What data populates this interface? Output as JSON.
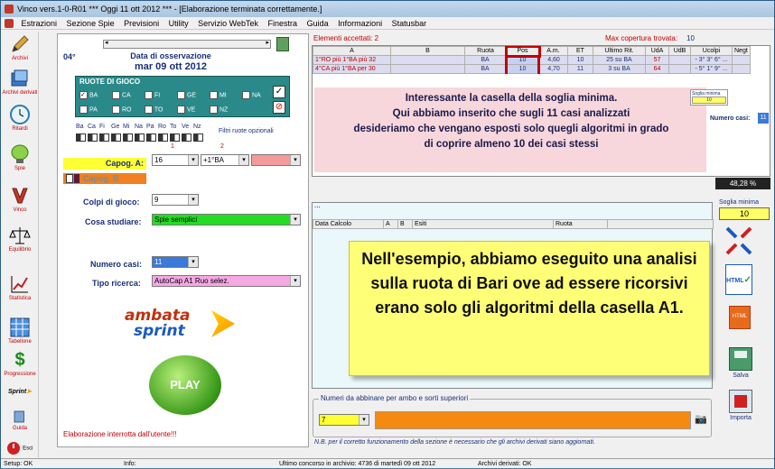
{
  "window": {
    "title": "Vinco vers.1-0-R01  ***  Oggi 11 ott 2012  ***   - [Elaborazione terminata correttamente.]"
  },
  "menu": [
    "Estrazioni",
    "Sezione Spie",
    "Previsioni",
    "Utility",
    "Servizio WebTek",
    "Finestra",
    "Guida",
    "Informazioni",
    "Statusbar"
  ],
  "toolbar": [
    {
      "label": "Archivi",
      "icon": "pencil-icon"
    },
    {
      "label": "Archivi derivati",
      "icon": "archive-icon"
    },
    {
      "label": "Ritardi",
      "icon": "clock-icon"
    },
    {
      "label": "Spie",
      "icon": "lamp-icon"
    },
    {
      "label": "Vinco",
      "icon": "vinco-logo-icon"
    },
    {
      "label": "Equilibrio",
      "icon": "scale-icon"
    },
    {
      "label": "Statistica",
      "icon": "chart-icon"
    },
    {
      "label": "Tabellone",
      "icon": "table-icon"
    },
    {
      "label": "Progressione",
      "icon": "dollar-icon"
    },
    {
      "label": "Sprint",
      "icon": "sprint-icon"
    },
    {
      "label": "Guida",
      "icon": "book-icon"
    },
    {
      "label": "Esci",
      "icon": "exit-icon"
    }
  ],
  "left": {
    "deg": "04°",
    "obs_label": "Data di osservazione",
    "obs_date": "mar 09 ott 2012",
    "ruote_title": "RUOTE DI GIOCO",
    "ruote_row1": [
      "BA",
      "CA",
      "FI",
      "GE",
      "MI",
      "NA"
    ],
    "ruote_row2": [
      "PA",
      "RO",
      "TO",
      "VE",
      "NZ"
    ],
    "ruote_checked": "BA",
    "abbr": [
      "Ba",
      "Ca",
      "Fi",
      "Ge",
      "Mi",
      "Na",
      "Pa",
      "Ro",
      "To",
      "Ve",
      "Nz"
    ],
    "filtri": "Filtri ruote opzionali",
    "col1": "1",
    "col2": "2",
    "capogA": "Capog. A:",
    "capogA_val1": "16",
    "capogA_val2": "+1°BA",
    "capogB": "Capog. B",
    "colpi_label": "Colpi di gioco:",
    "colpi_val": "9",
    "cosa_label": "Cosa studiare:",
    "cosa_val": "Spie semplici",
    "numero_label": "Numero casi:",
    "numero_val": "11",
    "tipo_label": "Tipo ricerca:",
    "tipo_val": "AutoCap A1 Ruo selez.",
    "logo_top": "ambata",
    "logo_bottom": "sprint",
    "play": "PLAY",
    "stop_msg": "Elaborazione interrotta dall'utente!!!"
  },
  "right": {
    "accettati": "Elementi accettati: 2",
    "max_cov_label": "Max copertura trovata:",
    "max_cov_val": "10",
    "headers": [
      "A",
      "B",
      "Ruota",
      "Pos",
      "A.m.",
      "ET",
      "Ultimo Rit.",
      "UdA",
      "UdB",
      "Ucolpi",
      "Negt"
    ],
    "rows": [
      [
        "1°RO più  1°BA  più 32",
        "",
        "BA",
        "10",
        "4,60",
        "10",
        "25 su BA",
        "57",
        "",
        "- 3° 3° 6° ...",
        ""
      ],
      [
        "4°CA più  1°BA  per 30",
        "",
        "BA",
        "10",
        "4,70",
        "11",
        "3 su BA",
        "64",
        "",
        "- 5° 1° 9° ...",
        ""
      ]
    ],
    "annotation1": "Interessante la casella della soglia minima.\nQui abbiamo inserito che sugli 11 casi analizzati\ndesideriamo che vengano esposti solo quegli algoritmi in grado\ndi coprire almeno 10 dei casi stessi",
    "mini_soglia_label": "Soglia minima",
    "mini_soglia_val": "10",
    "numero_casi_label": "Numero casi:",
    "numero_casi_val": "11",
    "percent": "48,28 %",
    "soglia_label": "Soglia minima",
    "soglia_val": "10",
    "dots": "...",
    "headers2": [
      "Data Calcolo",
      "A",
      "B",
      "Esiti",
      "Ruota"
    ],
    "annotation2": "Nell'esempio, abbiamo eseguito una analisi sulla ruota di Bari ove ad essere ricorsivi erano solo gli algoritmi della casella A1.",
    "numeri_label": "Numeri da abbinare per ambo e sorti superiori",
    "numeri_val": "7",
    "nb": "N.B. per il corretto funzionamento della sezione è necessario che gli archivi derivati siano aggiornati.",
    "salva": "Salva",
    "importa": "Importa"
  },
  "status": {
    "setup": "Setup: OK",
    "info": "Info:",
    "ultimo": "Ultimo concorso in archivio: 4736 di martedì 09 ott 2012",
    "derivati": "Archivi derivati: OK"
  },
  "colors": {
    "accent": "#1a2f7a",
    "teal": "#2a8a8a",
    "yellow": "#ffff66",
    "pink": "#f7d6dc",
    "highlight": "#c00000"
  }
}
